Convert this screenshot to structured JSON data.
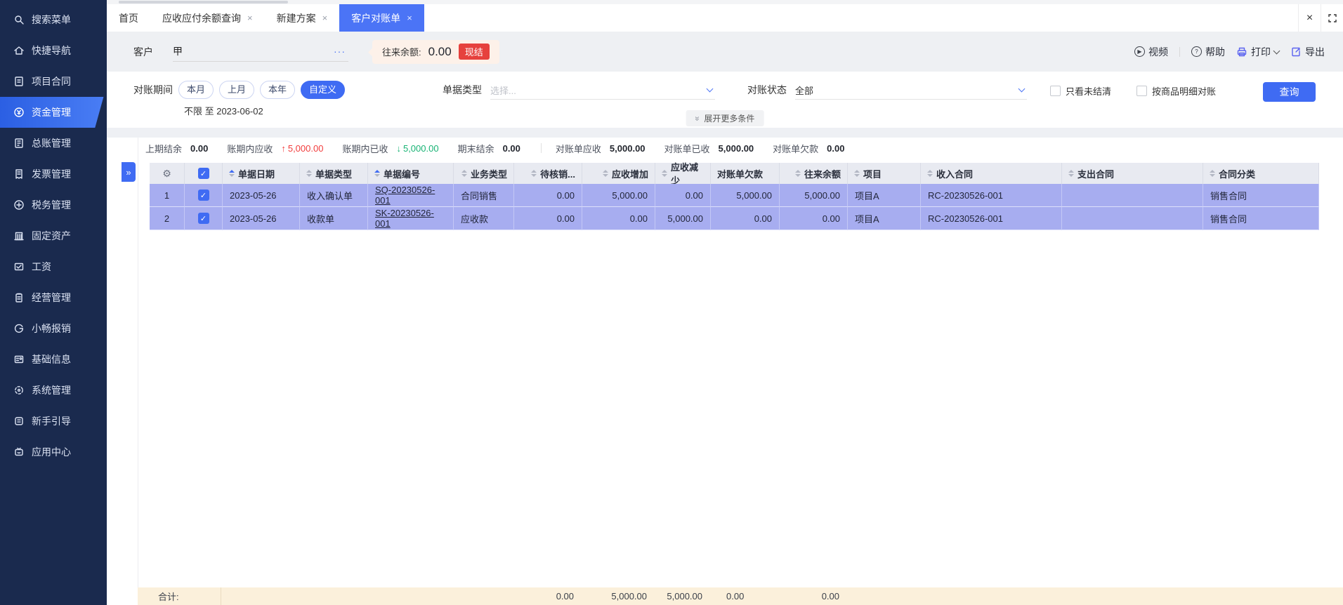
{
  "icons": {
    "close": "×",
    "check": "✓",
    "gear": "⚙",
    "more_dots": "···",
    "double_right": "»",
    "arrow_up": "↑",
    "arrow_down": "↓",
    "play": "▶",
    "question": "?"
  },
  "sidebar": {
    "items": [
      {
        "label": "搜索菜单"
      },
      {
        "label": "快捷导航"
      },
      {
        "label": "项目合同"
      },
      {
        "label": "资金管理"
      },
      {
        "label": "总账管理"
      },
      {
        "label": "发票管理"
      },
      {
        "label": "税务管理"
      },
      {
        "label": "固定资产"
      },
      {
        "label": "工资"
      },
      {
        "label": "经营管理"
      },
      {
        "label": "小畅报销"
      },
      {
        "label": "基础信息"
      },
      {
        "label": "系统管理"
      },
      {
        "label": "新手引导"
      },
      {
        "label": "应用中心"
      }
    ]
  },
  "tabs": [
    {
      "label": "首页"
    },
    {
      "label": "应收应付余额查询"
    },
    {
      "label": "新建方案"
    },
    {
      "label": "客户对账单"
    }
  ],
  "customer_bar": {
    "field_label": "客户",
    "value": "甲",
    "balance_label": "往来余额:",
    "balance_value": "0.00",
    "badge": "现结"
  },
  "top_actions": {
    "video": "视频",
    "help": "帮助",
    "print": "打印",
    "export": "导出"
  },
  "filters": {
    "period_label": "对账期间",
    "period_options": [
      {
        "label": "本月"
      },
      {
        "label": "上月"
      },
      {
        "label": "本年"
      },
      {
        "label": "自定义"
      }
    ],
    "period_range": "不限 至 2023-06-02",
    "doc_type_label": "单据类型",
    "doc_type_placeholder": "选择...",
    "status_label": "对账状态",
    "status_value": "全部",
    "checkbox_unsettled": "只看未结清",
    "checkbox_by_goods": "按商品明细对账",
    "search_button": "查询",
    "expand_more": "展开更多条件"
  },
  "summary": {
    "items": [
      {
        "label": "上期结余",
        "value": "0.00"
      },
      {
        "label": "账期内应收",
        "value": "5,000.00"
      },
      {
        "label": "账期内已收",
        "value": "5,000.00"
      },
      {
        "label": "期末结余",
        "value": "0.00"
      },
      {
        "label": "对账单应收",
        "value": "5,000.00"
      },
      {
        "label": "对账单已收",
        "value": "5,000.00"
      },
      {
        "label": "对账单欠款",
        "value": "0.00"
      }
    ]
  },
  "table": {
    "columns": [
      {
        "label": "单据日期"
      },
      {
        "label": "单据类型"
      },
      {
        "label": "单据编号"
      },
      {
        "label": "业务类型"
      },
      {
        "label": "待核销..."
      },
      {
        "label": "应收增加"
      },
      {
        "label": "应收减少"
      },
      {
        "label": "对账单欠款"
      },
      {
        "label": "往来余额"
      },
      {
        "label": "项目"
      },
      {
        "label": "收入合同"
      },
      {
        "label": "支出合同"
      },
      {
        "label": "合同分类"
      }
    ],
    "rows": [
      {
        "index": "1",
        "date": "2023-05-26",
        "doc_type": "收入确认单",
        "doc_no": "SQ-20230526-001",
        "biz_type": "合同销售",
        "pending": "0.00",
        "recv_increase": "5,000.00",
        "recv_decrease": "0.00",
        "statement_debt": "5,000.00",
        "balance": "5,000.00",
        "project": "项目A",
        "income_contract": "RC-20230526-001",
        "expense_contract": "",
        "contract_category": "销售合同"
      },
      {
        "index": "2",
        "date": "2023-05-26",
        "doc_type": "收款单",
        "doc_no": "SK-20230526-001",
        "biz_type": "应收款",
        "pending": "0.00",
        "recv_increase": "0.00",
        "recv_decrease": "5,000.00",
        "statement_debt": "0.00",
        "balance": "0.00",
        "project": "项目A",
        "income_contract": "RC-20230526-001",
        "expense_contract": "",
        "contract_category": "销售合同"
      }
    ],
    "footer": {
      "label": "合计:",
      "pending": "0.00",
      "recv_increase": "5,000.00",
      "recv_decrease": "5,000.00",
      "statement_debt": "0.00",
      "balance": "0.00"
    }
  },
  "colors": {
    "accent": "#3f6bf3",
    "danger": "#e6413d",
    "success": "#17b374",
    "row_highlight": "#a7adf0",
    "sidebar": "#1a2a4e",
    "footer_bg": "#fbf0db"
  }
}
